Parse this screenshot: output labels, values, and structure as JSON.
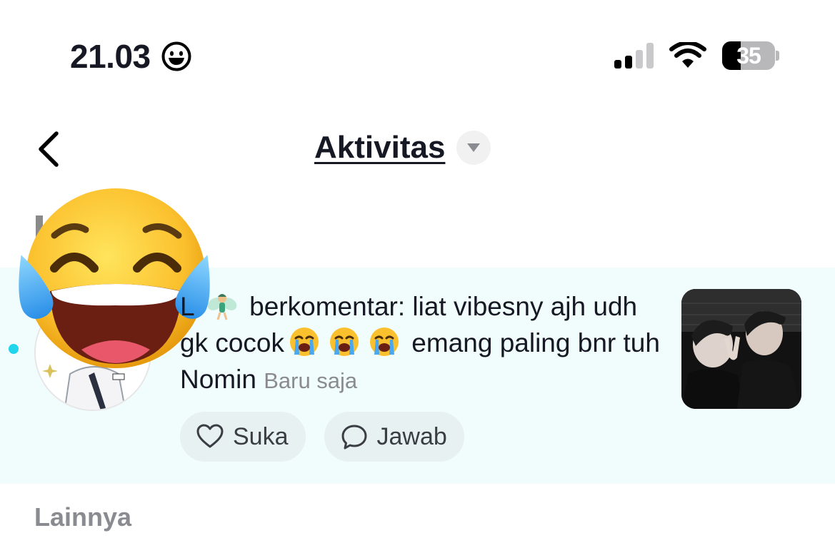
{
  "status_bar": {
    "time": "21.03",
    "battery_percent": "35",
    "signal_bars_active": 2
  },
  "header": {
    "title": "Aktivitas"
  },
  "notification": {
    "username": "L",
    "action_text": "berkomentar: liat vibesny ajh udh gk cocok",
    "suffix_text": "emang paling bnr tuh Nomin",
    "timestamp": "Baru saja",
    "like_label": "Suka",
    "reply_label": "Jawab",
    "unread": true
  },
  "sections": {
    "more_label": "Lainnya"
  },
  "colors": {
    "accent_cyan": "#20d5ec",
    "card_background": "#f1fcfc",
    "secondary_text": "#8a8b91"
  },
  "icons": {
    "status_emoji": "smiling-face-icon",
    "overlay_emoji": "tears-of-joy-emoji",
    "inline_emoji": "loudly-crying-face-emoji",
    "name_emoji": "fairy-emoji"
  }
}
